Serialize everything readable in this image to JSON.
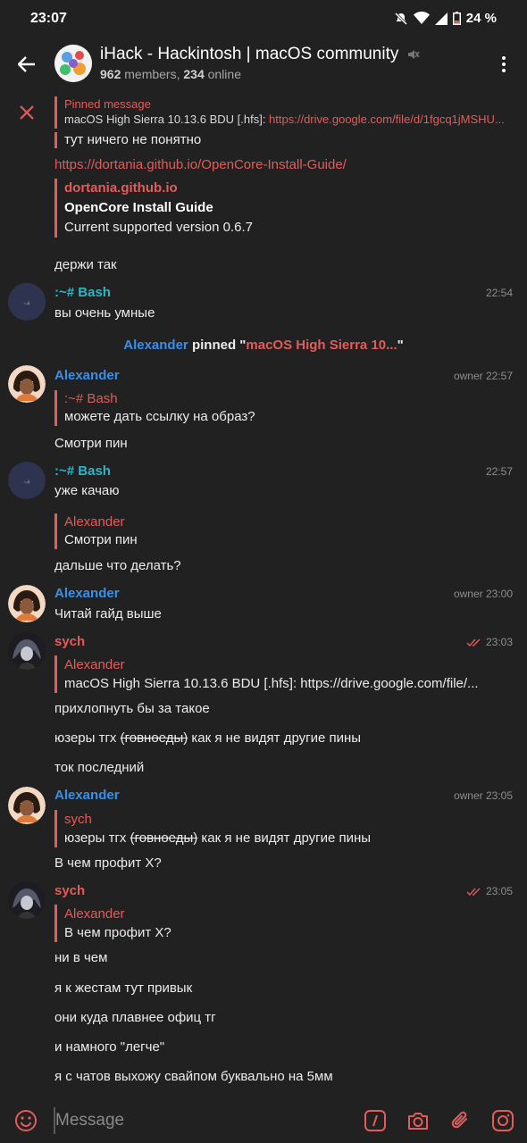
{
  "status": {
    "time": "23:07",
    "battery": "24 %"
  },
  "header": {
    "title": "iHack - Hackintosh | macOS community",
    "members_count": "962",
    "members_label": "members,",
    "online_count": "234",
    "online_label": "online"
  },
  "pinned": {
    "label": "Pinned message",
    "text": "macOS High Sierra 10.13.6 BDU [.hfs]: ",
    "link": "https://drive.google.com/file/d/1fgcq1jMSHU..."
  },
  "messages": {
    "m1": {
      "text": "тут ничего не понятно"
    },
    "m2": {
      "link": "https://dortania.github.io/OpenCore-Install-Guide/"
    },
    "preview": {
      "site": "dortania.github.io",
      "title": "OpenCore Install Guide",
      "desc": "Current supported version 0.6.7"
    },
    "m3": {
      "text": "держи так"
    },
    "m4": {
      "sender": ":~# Bash",
      "time": "22:54",
      "text": "вы очень умные"
    },
    "service": {
      "actor": "Alexander",
      "verb": " pinned \"",
      "target": "macOS High Sierra 10...",
      "end": "\""
    },
    "m5": {
      "sender": "Alexander",
      "badge": "owner",
      "time": "22:57",
      "reply_name": ":~# Bash",
      "reply_text": "можете дать ссылку на образ?",
      "text": "Смотри пин"
    },
    "m6": {
      "sender": ":~# Bash",
      "time": "22:57",
      "text": "уже качаю",
      "reply_name": "Alexander",
      "reply_text": "Смотри пин",
      "text2": "дальше что делать?"
    },
    "m7": {
      "sender": "Alexander",
      "badge": "owner",
      "time": "23:00",
      "text": "Читай гайд выше"
    },
    "m8": {
      "sender": "sych",
      "time": "23:03",
      "reply_name": "Alexander",
      "reply_text": "macOS High Sierra 10.13.6 BDU [.hfs]: https://drive.google.com/file/...",
      "text": "прихлопнуть бы за такое",
      "text2a": "юзеры тгх ",
      "text2s": "(говноеды)",
      "text2b": " как я не видят другие пины",
      "text3": "ток последний"
    },
    "m9": {
      "sender": "Alexander",
      "badge": "owner",
      "time": "23:05",
      "reply_name": "sych",
      "reply_a": "юзеры тгх ",
      "reply_s": "(говноеды)",
      "reply_b": " как я не видят другие пины",
      "text": "В чем профит X?"
    },
    "m10": {
      "sender": "sych",
      "time": "23:05",
      "reply_name": "Alexander",
      "reply_text": "В чем профит X?",
      "t1": "ни в чем",
      "t2": "я к жестам тут привык",
      "t3": "они куда плавнее офиц тг",
      "t4": "и намного \"легче\"",
      "t5": "я с чатов выхожу свайпом буквально на 5мм"
    }
  },
  "composer": {
    "placeholder": "Message"
  },
  "colors": {
    "bg": "#212121",
    "accent_red": "#e35b5b",
    "accent_blue": "#3a8fe8",
    "accent_teal": "#2bb7c9"
  }
}
